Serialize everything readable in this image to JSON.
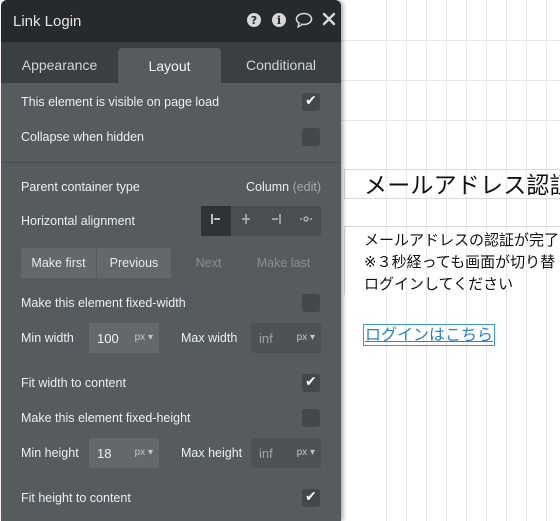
{
  "panel": {
    "title": "Link Login",
    "icons": [
      "help-icon",
      "info-icon",
      "comment-icon",
      "close-icon"
    ],
    "tabs": [
      "Appearance",
      "Layout",
      "Conditional"
    ],
    "active_tab": "Layout",
    "visible_on_load": {
      "label": "This element is visible on page load",
      "checked": true
    },
    "collapse_hidden": {
      "label": "Collapse when hidden",
      "checked": false
    },
    "parent_container": {
      "label": "Parent container type",
      "value": "Column",
      "edit": "(edit)"
    },
    "horizontal_alignment": {
      "label": "Horizontal alignment",
      "options": [
        "align-left-icon",
        "align-center-icon",
        "align-right-icon",
        "align-distribute-icon"
      ],
      "active": 0
    },
    "order_buttons": {
      "make_first": "Make first",
      "previous": "Previous",
      "next": "Next",
      "make_last": "Make last"
    },
    "fixed_width": {
      "label": "Make this element fixed-width",
      "checked": false
    },
    "min_width": {
      "label": "Min width",
      "value": "100",
      "unit": "px"
    },
    "max_width": {
      "label": "Max width",
      "placeholder": "inf",
      "unit": "px"
    },
    "fit_width": {
      "label": "Fit width to content",
      "checked": true
    },
    "fixed_height": {
      "label": "Make this element fixed-height",
      "checked": false
    },
    "min_height": {
      "label": "Min height",
      "value": "18",
      "unit": "px"
    },
    "max_height": {
      "label": "Max height",
      "placeholder": "inf",
      "unit": "px"
    },
    "fit_height": {
      "label": "Fit height to content",
      "checked": true
    }
  },
  "canvas": {
    "heading": "メールアドレス認証",
    "body_lines": [
      "メールアドレスの認証が完了",
      "※３秒経っても画面が切り替",
      "ログインしてください"
    ],
    "link": "ログインはこちら"
  }
}
